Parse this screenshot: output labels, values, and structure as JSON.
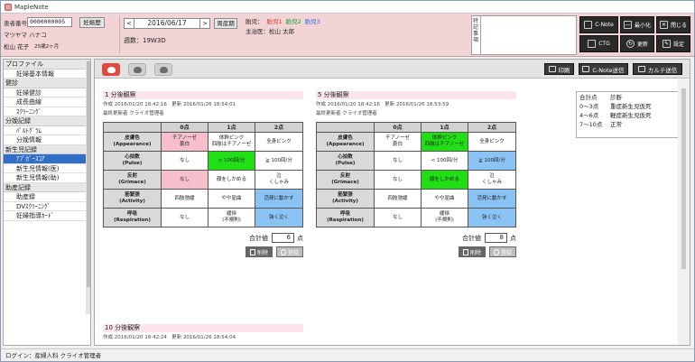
{
  "app": {
    "title": "MapleNote"
  },
  "patient": {
    "id_label": "患者番号",
    "id": "0000000005",
    "kana_name": "マツヤマ ハナコ",
    "name": "松山 花子",
    "age": "25歳2ヶ月",
    "pregnancy_button": "妊娠歴"
  },
  "date_nav": {
    "prev": "<",
    "date": "2016/06/17",
    "next": ">",
    "period_button": "周産期",
    "weeks": "週数：19W3D"
  },
  "info": {
    "status_label": "胎児：",
    "fetus1": "胎児1",
    "fetus2": "胎児2",
    "fetus3": "胎児3",
    "doctor_label": "主治医：",
    "doctor": "松山 太郎"
  },
  "memo": {
    "label": "特記事項",
    "value": ""
  },
  "toolbar": {
    "cnote": "C-Note",
    "minimize": "最小化",
    "close": "閉じる",
    "ctg": "CTG",
    "update": "更新",
    "settings": "設定"
  },
  "sidebar": [
    {
      "type": "category",
      "label": "プロファイル"
    },
    {
      "type": "item",
      "label": "妊婦基本情報"
    },
    {
      "type": "category",
      "label": "健診"
    },
    {
      "type": "item",
      "label": "妊婦健診"
    },
    {
      "type": "item",
      "label": "成長曲線"
    },
    {
      "type": "item",
      "label": "ｽｸﾘｰﾆﾝｸﾞ"
    },
    {
      "type": "category",
      "label": "分娩記録"
    },
    {
      "type": "item",
      "label": "ﾊﾟﾙﾄｸﾞﾗﾑ"
    },
    {
      "type": "item",
      "label": "分娩情報"
    },
    {
      "type": "category",
      "label": "新生児記録"
    },
    {
      "type": "item",
      "label": "ｱﾌﾟｶﾞｰｽｺｱ",
      "active": true
    },
    {
      "type": "item",
      "label": "新生児情報(医)"
    },
    {
      "type": "item",
      "label": "新生児情報(助)"
    },
    {
      "type": "category",
      "label": "助産記録"
    },
    {
      "type": "item",
      "label": "助産録"
    },
    {
      "type": "item",
      "label": "DVｽｸﾘｰﾆﾝｸﾞ"
    },
    {
      "type": "item",
      "label": "妊婦指導ｶｰﾄﾞ"
    }
  ],
  "main_toolbar": {
    "print": "印刷",
    "cnote_send": "C-Note送信",
    "karte_send": "カルテ送信"
  },
  "score_headers": [
    "0点",
    "1点",
    "2点"
  ],
  "row_headers": [
    {
      "ja": "皮膚色",
      "en": "(Appearance)"
    },
    {
      "ja": "心拍数",
      "en": "(Pulse)"
    },
    {
      "ja": "反射",
      "en": "(Grimace)"
    },
    {
      "ja": "筋緊張",
      "en": "(Activity)"
    },
    {
      "ja": "呼吸",
      "en": "(Respiration)"
    }
  ],
  "cells": [
    [
      [
        "チアノーゼ",
        "蒼白"
      ],
      [
        "体幹ピンク",
        "四肢はチアノーゼ"
      ],
      [
        "全身ピンク"
      ]
    ],
    [
      [
        "なし"
      ],
      [
        "< 100回/分"
      ],
      [
        "≧ 100回/分"
      ]
    ],
    [
      [
        "なし"
      ],
      [
        "顔をしかめる"
      ],
      [
        "泣",
        "くしゃみ"
      ]
    ],
    [
      [
        "四肢弛緩"
      ],
      [
        "やや屈曲"
      ],
      [
        "活発に動かす"
      ]
    ],
    [
      [
        "なし"
      ],
      [
        "緩徐",
        "(不規則)"
      ],
      [
        "強く泣く"
      ]
    ]
  ],
  "sections": [
    {
      "title": "1 分後観察",
      "created_label": "作成",
      "created": "2016/01/20 18:42:16",
      "updated_label": "更新",
      "updated": "2016/01/26 18:54:01",
      "updater": "最終更新者 クライオ管理者",
      "selected": [
        0,
        1,
        0,
        2,
        2
      ],
      "total_label": "合計値",
      "total": "6",
      "unit": "点",
      "delete": "削除",
      "register": "登録"
    },
    {
      "title": "5 分後観察",
      "created_label": "作成",
      "created": "2016/01/20 18:42:16",
      "updated_label": "更新",
      "updated": "2016/01/26 18:53:59",
      "updater": "最終更新者 クライオ管理者",
      "selected": [
        1,
        2,
        1,
        2,
        2
      ],
      "total_label": "合計値",
      "total": "8",
      "unit": "点",
      "delete": "削除",
      "register": "登録"
    },
    {
      "title": "10 分後観察",
      "created_label": "作成",
      "created": "2016/01/20 18:42:24",
      "updated_label": "更新",
      "updated": "2016/01/26 18:54:04"
    }
  ],
  "legend": {
    "header": [
      "合計点",
      "診断"
    ],
    "rows": [
      [
        "0〜3点",
        "重症新生児仮死"
      ],
      [
        "4〜6点",
        "軽症新生児仮死"
      ],
      [
        "7〜10点",
        "正常"
      ]
    ]
  },
  "status": {
    "login": "ログイン：産婦人科 クライオ管理者"
  },
  "colors": {
    "header_bg": "#f3d4d6",
    "selected_low": "#f7bfcc",
    "selected_mid": "#21df14",
    "selected_high": "#8ac3f4",
    "active_nav": "#2f6fc7",
    "mode_active": "#e04840"
  }
}
